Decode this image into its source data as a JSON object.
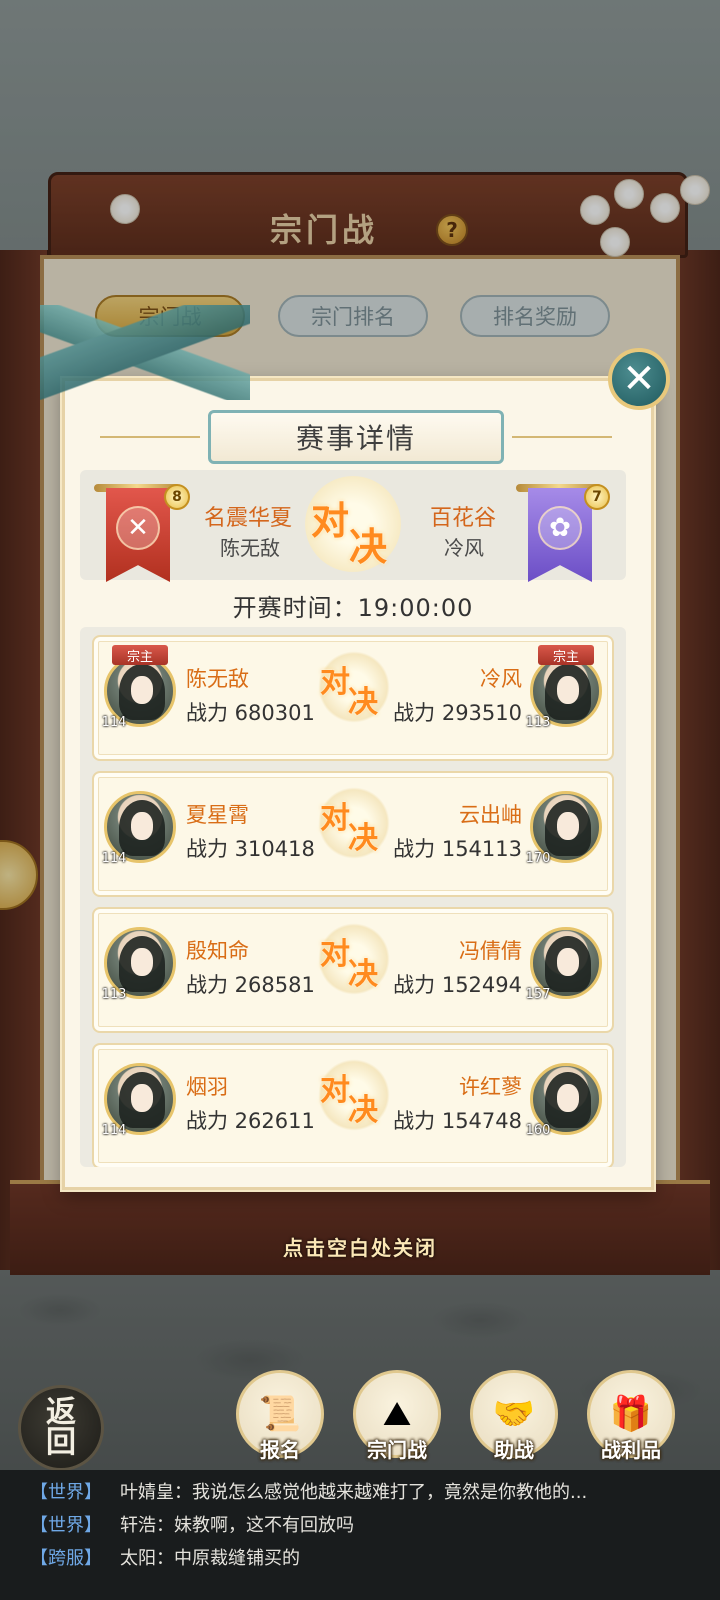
{
  "background": {
    "frame_title": "宗门战",
    "help_icon": "question-icon",
    "tabs": [
      {
        "label": "宗门战",
        "active": true
      },
      {
        "label": "宗门排名",
        "active": false
      },
      {
        "label": "排名奖励",
        "active": false
      }
    ]
  },
  "modal": {
    "title": "赛事详情",
    "close_icon": "close-icon",
    "vs_chars": [
      "对",
      "决"
    ],
    "left_sect": {
      "name": "名震华夏",
      "leader": "陈无敌",
      "level": "8",
      "color": "#c83a2a",
      "emblem": "crossed-swords-icon"
    },
    "right_sect": {
      "name": "百花谷",
      "leader": "冷风",
      "level": "7",
      "color": "#7d5fd6",
      "emblem": "lotus-icon"
    },
    "start_time": "开赛时间：19:00:00",
    "matches": [
      {
        "left": {
          "name": "陈无敌",
          "power": "战力 680301",
          "level": "114",
          "tag": "宗主"
        },
        "right": {
          "name": "冷风",
          "power": "战力 293510",
          "level": "113",
          "tag": "宗主"
        }
      },
      {
        "left": {
          "name": "夏星霄",
          "power": "战力 310418",
          "level": "114",
          "tag": ""
        },
        "right": {
          "name": "云出岫",
          "power": "战力 154113",
          "level": "170",
          "tag": ""
        }
      },
      {
        "left": {
          "name": "殷知命",
          "power": "战力 268581",
          "level": "113",
          "tag": ""
        },
        "right": {
          "name": "冯倩倩",
          "power": "战力 152494",
          "level": "157",
          "tag": ""
        }
      },
      {
        "left": {
          "name": "烟羽",
          "power": "战力 262611",
          "level": "114",
          "tag": ""
        },
        "right": {
          "name": "许红蓼",
          "power": "战力 154748",
          "level": "160",
          "tag": ""
        }
      }
    ]
  },
  "hint": "点击空白处关闭",
  "nav": {
    "back": [
      "返",
      "回"
    ],
    "items": [
      {
        "label": "报名",
        "icon": "scroll-icon"
      },
      {
        "label": "宗门战",
        "icon": "flag-mountain-icon"
      },
      {
        "label": "助战",
        "icon": "handshake-icon"
      },
      {
        "label": "战利品",
        "icon": "treasure-chest-icon"
      }
    ]
  },
  "chat": [
    {
      "channel": "【世界】",
      "text": "叶婧皇：我说怎么感觉他越来越难打了，竟然是你教他的..."
    },
    {
      "channel": "【世界】",
      "text": "轩浩：妹教啊，这不有回放吗"
    },
    {
      "channel": "【跨服】",
      "text": "太阳：中原裁缝铺买的"
    }
  ]
}
